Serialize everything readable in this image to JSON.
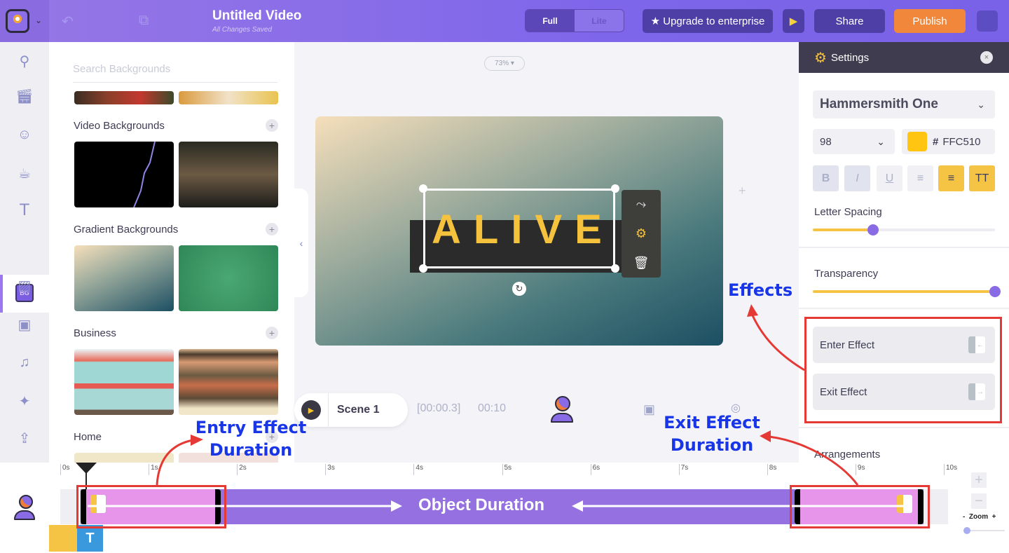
{
  "topbar": {
    "title": "Untitled Video",
    "subtitle": "All Changes Saved",
    "mode_full": "Full",
    "mode_lite": "Lite",
    "upgrade": "★ Upgrade to enterprise",
    "play_icon": "▶",
    "share": "Share",
    "publish": "Publish"
  },
  "rail": {
    "items": [
      "search",
      "scenes",
      "characters",
      "props",
      "text",
      "backgrounds",
      "images",
      "videos",
      "music",
      "effects",
      "upload"
    ],
    "bg_badge": "BG"
  },
  "panel": {
    "search_placeholder": "Search Backgrounds",
    "sections": [
      {
        "title": "Video Backgrounds",
        "add": "+"
      },
      {
        "title": "Gradient Backgrounds",
        "add": "+"
      },
      {
        "title": "Business",
        "add": "+"
      },
      {
        "title": "Home",
        "add": "+"
      }
    ]
  },
  "canvas": {
    "zoom": "73% ▾",
    "text": "ALIVE",
    "text_color": "#FFC510",
    "collapse_icon": "‹",
    "scene_name": "Scene 1",
    "scene_time": "[00:00.3]",
    "scene_duration": "00:10"
  },
  "settings": {
    "header": "Settings",
    "close": "×",
    "font": "Hammersmith One",
    "size": "98",
    "color_hash": "#",
    "color_hex": "FFC510",
    "format_buttons": [
      "B",
      "I",
      "U",
      "≡",
      "≡",
      "TT"
    ],
    "letter_spacing_label": "Letter Spacing",
    "letter_spacing_value": 0.33,
    "transparency_label": "Transparency",
    "transparency_value": 1.0,
    "enter_effect": "Enter Effect",
    "exit_effect": "Exit Effect",
    "arrangements": "Arrangements"
  },
  "timeline": {
    "ticks": [
      "0s",
      "1s",
      "2s",
      "3s",
      "4s",
      "5s",
      "6s",
      "7s",
      "8s",
      "9s",
      "10s"
    ],
    "object_label": "Object Duration",
    "zoom_label": "-  Zoom  +",
    "zoom_in": "+",
    "zoom_out": "−",
    "layer_text": "T"
  },
  "annotations": {
    "effects": "Effects",
    "entry": "Entry Effect Duration",
    "entry_l1": "Entry Effect",
    "entry_l2": "Duration",
    "exit_l1": "Exit Effect",
    "exit_l2": "Duration"
  }
}
